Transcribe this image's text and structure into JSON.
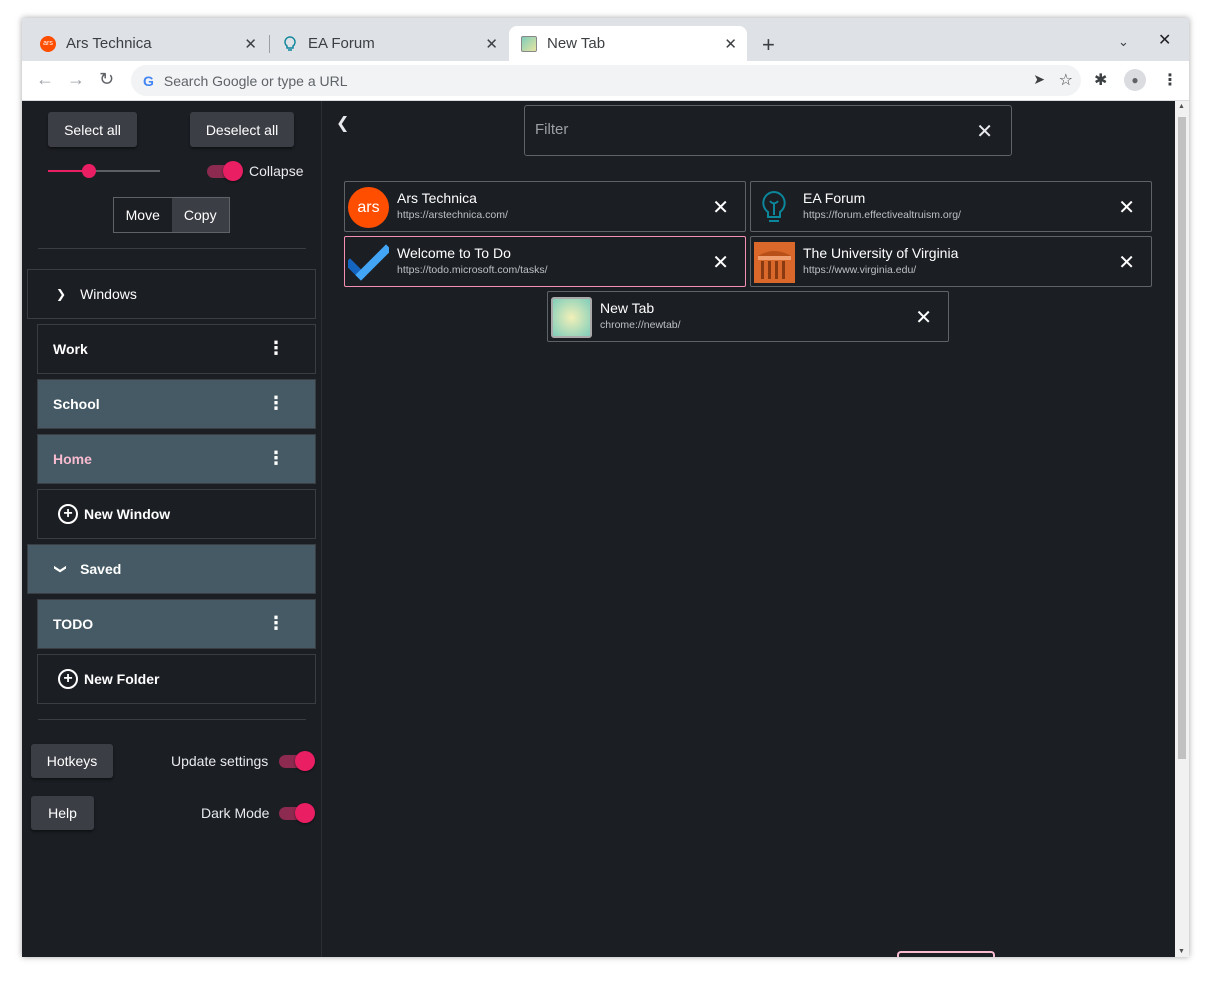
{
  "browser": {
    "tabs": [
      {
        "title": "Ars Technica",
        "icon": "ars-technica-favicon",
        "active": false
      },
      {
        "title": "EA Forum",
        "icon": "ea-forum-favicon",
        "active": false
      },
      {
        "title": "New Tab",
        "icon": "new-tab-favicon",
        "active": true
      }
    ],
    "omnibox_placeholder": "Search Google or type a URL"
  },
  "sidebar": {
    "select_all": "Select all",
    "deselect_all": "Deselect all",
    "size_slider_level": 0.37,
    "collapse_label": "Collapse",
    "collapse_on": true,
    "move_label": "Move",
    "copy_label": "Copy",
    "windows_header": "Windows",
    "windows": [
      {
        "name": "Work",
        "selected": false
      },
      {
        "name": "School",
        "selected": true
      },
      {
        "name": "Home",
        "selected": true
      }
    ],
    "new_window": "New Window",
    "saved_header": "Saved",
    "folders": [
      {
        "name": "TODO",
        "selected": true
      }
    ],
    "new_folder": "New Folder",
    "hotkeys": "Hotkeys",
    "help": "Help",
    "update_settings": "Update settings",
    "dark_mode": "Dark Mode"
  },
  "main": {
    "filter_placeholder": "Filter",
    "tabs": [
      {
        "title": "Ars Technica",
        "url": "https://arstechnica.com/"
      },
      {
        "title": "EA Forum",
        "url": "https://forum.effectivealtruism.org/"
      },
      {
        "title": "Welcome to To Do",
        "url": "https://todo.microsoft.com/tasks/"
      },
      {
        "title": "The University of Virginia",
        "url": "https://www.virginia.edu/"
      },
      {
        "title": "New Tab",
        "url": "chrome://newtab/"
      }
    ]
  },
  "colors": {
    "background": "#1b1e23",
    "accent": "#e91e63",
    "selected_row": "#455a64",
    "home_text": "#f8bbd0",
    "highlight_border": "#f48fb1"
  }
}
